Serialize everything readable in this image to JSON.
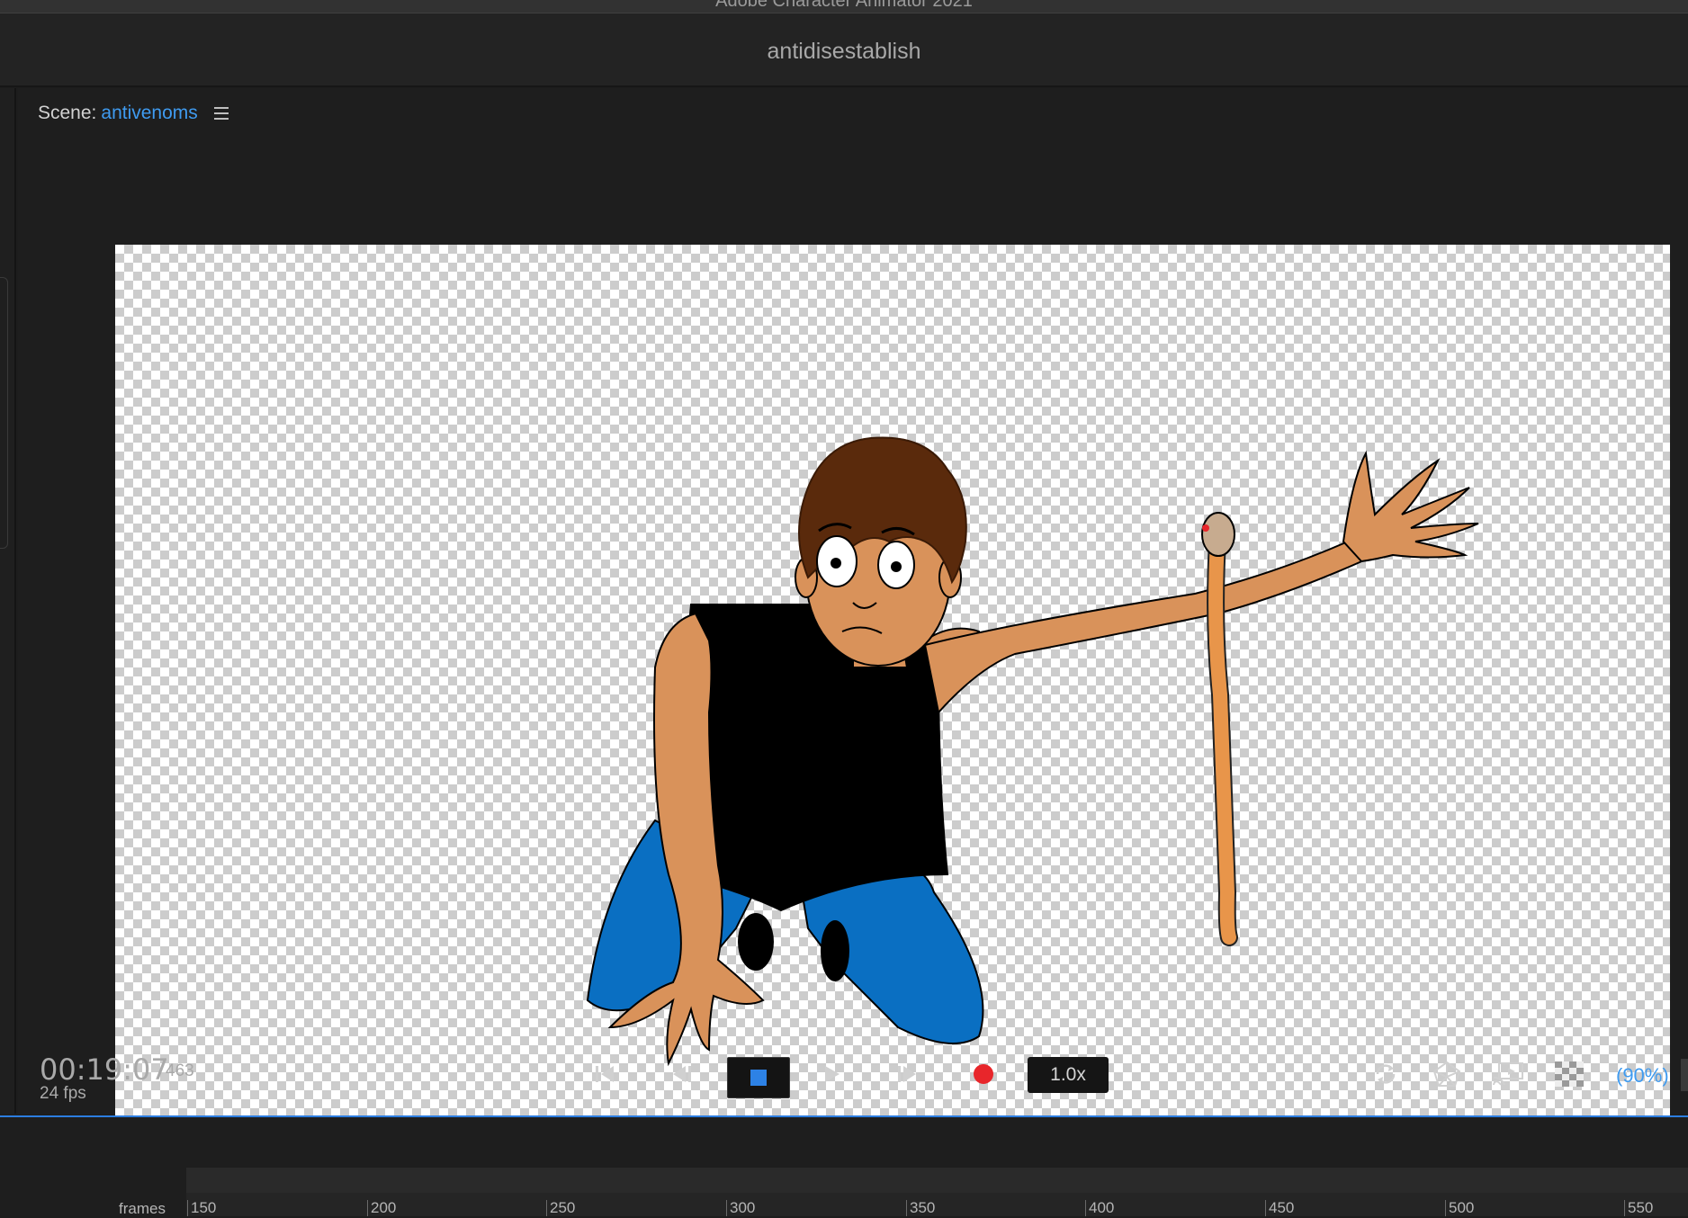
{
  "app": {
    "title": "Adobe Character Animator 2021"
  },
  "project": {
    "name": "antidisestablish"
  },
  "scene": {
    "label": "Scene:",
    "name": "antivenoms",
    "menu_icon": "hamburger-menu-icon"
  },
  "transport": {
    "timecode": "00:19:07",
    "frame": "463",
    "fps": "24 fps",
    "speed": "1.0x",
    "zoom": "(90%)",
    "buttons": [
      "go-to-start-icon",
      "step-back-icon",
      "stop-icon",
      "play-icon",
      "step-forward-icon",
      "record-icon"
    ],
    "right_icons": [
      "loop-icon",
      "wireframe-icon",
      "cast-output-icon",
      "transparency-grid-icon"
    ]
  },
  "colors": {
    "accent": "#3f9bf0",
    "record": "#e8262b",
    "stop": "#2d82e6",
    "skin": "#d9925a",
    "hair": "#5a2a0c",
    "jeans": "#0a6fc2",
    "shirt": "#000000",
    "snake": "#e8954a"
  },
  "timeline": {
    "frames_label": "frames",
    "ticks": [
      "150",
      "200",
      "250",
      "300",
      "350",
      "400",
      "450",
      "500",
      "550"
    ]
  }
}
